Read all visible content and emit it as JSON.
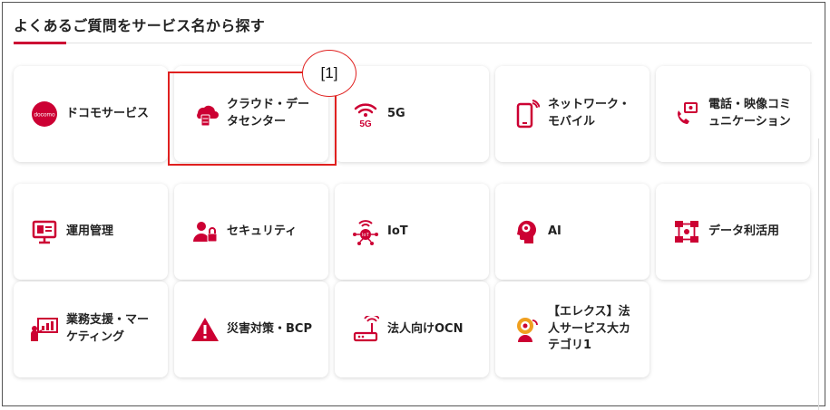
{
  "heading": "よくあるご質問をサービス名から探す",
  "colors": {
    "accent": "#cc0033",
    "annotation": "#e0201f"
  },
  "annotation_label": "[1]",
  "tiles": [
    {
      "label": "ドコモサービス",
      "icon": "docomo-logo-icon",
      "logo_text": "docomo"
    },
    {
      "label": "クラウド・データセンター",
      "icon": "cloud-server-icon"
    },
    {
      "label": "5G",
      "icon": "5g-signal-icon",
      "icon_text": "5G"
    },
    {
      "label": "ネットワーク・モバイル",
      "icon": "smartphone-icon"
    },
    {
      "label": "電話・映像コミュニケーション",
      "icon": "phone-video-icon"
    },
    {
      "label": "運用管理",
      "icon": "monitor-dashboard-icon"
    },
    {
      "label": "セキュリティ",
      "icon": "user-lock-icon"
    },
    {
      "label": "IoT",
      "icon": "iot-network-icon",
      "icon_text": "IoT"
    },
    {
      "label": "AI",
      "icon": "ai-head-gear-icon"
    },
    {
      "label": "データ利活用",
      "icon": "data-flow-icon"
    },
    {
      "label": "業務支援・マーケティング",
      "icon": "presentation-icon"
    },
    {
      "label": "災害対策・BCP",
      "icon": "warning-icon"
    },
    {
      "label": "法人向けOCN",
      "icon": "router-icon"
    },
    {
      "label": "【エレクス】法人サービス大カテゴリ1",
      "icon": "support-person-icon"
    }
  ]
}
